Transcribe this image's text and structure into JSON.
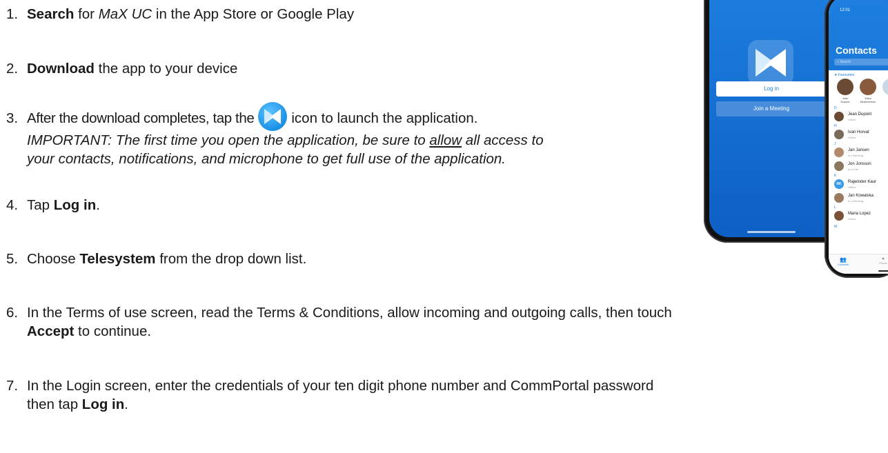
{
  "steps": [
    {
      "number": "1.",
      "bold": "Search",
      "text_before": " for ",
      "italic": "MaX UC",
      "text_after": " in the App Store or Google Play"
    },
    {
      "number": "2.",
      "bold": "Download",
      "text": " the app to your device"
    },
    {
      "number": "3.",
      "text_before": "After the download completes, tap the",
      "text_after": "icon to launch the application.",
      "note_before": "IMPORTANT: The first time you open the application, be sure to ",
      "note_underline": "allow",
      "note_after": " all access to",
      "note_line2": "your contacts, notifications, and microphone to get full use of the application."
    },
    {
      "number": "4.",
      "text": "Tap ",
      "bold": "Log in",
      "text_after": "."
    },
    {
      "number": "5.",
      "text": "Choose ",
      "bold": "Telesystem",
      "text_after": " from the drop down list."
    },
    {
      "number": "6.",
      "text": "In the Terms of use screen, read the Terms & Conditions, allow incoming and outgoing calls, then touch",
      "bold": "Accept",
      "text_after": " to continue."
    },
    {
      "number": "7.",
      "text": "In the Login screen, enter the credentials of your ten digit phone number and CommPortal password",
      "text_line2": "then tap ",
      "bold": "Log in",
      "text_after": "."
    }
  ],
  "icons": {
    "inline_app_icon": "max-uc-app-icon"
  },
  "phone_back": {
    "login_label": "Log in",
    "join_label": "Join a Meeting"
  },
  "phone_front": {
    "time": "12:01",
    "title": "Contacts",
    "search_placeholder": "Search",
    "favourites_label": "Favourites",
    "favourites": [
      {
        "first": "Jean",
        "last": "Dupont"
      },
      {
        "first": "Erika",
        "last": "Mustermann"
      }
    ],
    "sections": [
      {
        "letter": "D",
        "name": "Jean Dupont",
        "status": "Online"
      },
      {
        "letter": "H",
        "name": "Ivan Horvat",
        "status": "Online"
      },
      {
        "letter": "J",
        "name": "Jan Jansen",
        "status": "In a Meeting"
      },
      {
        "letter": "",
        "name": "Jon Jonsson",
        "status": "In a Call"
      },
      {
        "letter": "K",
        "name": "Rajwinder Kaur",
        "status": "Offline",
        "initials": "RK"
      },
      {
        "letter": "",
        "name": "Jan Kowalska",
        "status": "In a Meeting"
      },
      {
        "letter": "L",
        "name": "Maria Lopez",
        "status": "Online"
      },
      {
        "letter": "M",
        "name": "",
        "status": ""
      }
    ],
    "tabs": {
      "contacts": "Contacts",
      "phone": "Phone"
    }
  },
  "colors": {
    "accent": "#1d7fe0",
    "online": "#3cb043"
  }
}
